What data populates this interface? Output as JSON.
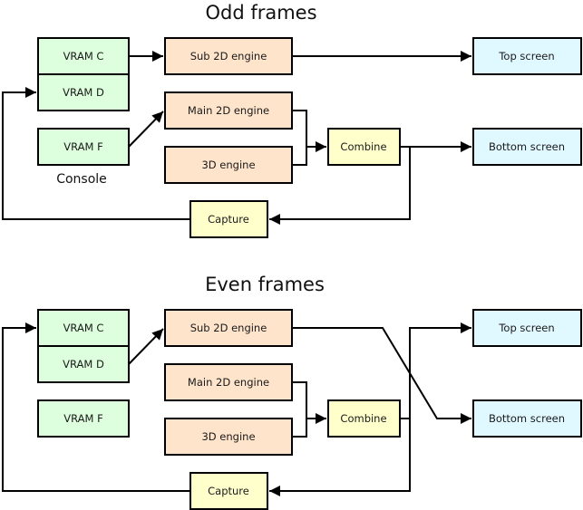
{
  "colors": {
    "memory": "#ddffdd",
    "engine": "#ffe4cc",
    "combiner": "#ffffcc",
    "screen": "#e0f8ff",
    "line": "#000000"
  },
  "panels": [
    {
      "id": "odd",
      "title": "Odd frames",
      "nodes": {
        "vram_c": {
          "label": "VRAM C",
          "kind": "memory"
        },
        "vram_d": {
          "label": "VRAM D",
          "kind": "memory"
        },
        "vram_f": {
          "label": "VRAM F",
          "kind": "memory"
        },
        "sub2d": {
          "label": "Sub 2D engine",
          "kind": "engine"
        },
        "main2d": {
          "label": "Main 2D engine",
          "kind": "engine"
        },
        "engine3d": {
          "label": "3D engine",
          "kind": "engine"
        },
        "combine": {
          "label": "Combine",
          "kind": "combiner"
        },
        "capture": {
          "label": "Capture",
          "kind": "combiner"
        },
        "top": {
          "label": "Top screen",
          "kind": "screen"
        },
        "bottom": {
          "label": "Bottom screen",
          "kind": "screen"
        }
      },
      "annotation": "Console",
      "edges": [
        {
          "from": "vram_c",
          "to": "sub2d"
        },
        {
          "from": "vram_f",
          "to": "main2d"
        },
        {
          "from": "sub2d",
          "to": "top"
        },
        {
          "from": "main2d",
          "to": "combine"
        },
        {
          "from": "engine3d",
          "to": "combine"
        },
        {
          "from": "combine",
          "to": "bottom"
        },
        {
          "from": "combine",
          "to": "capture"
        },
        {
          "from": "capture",
          "to": "vram_d"
        }
      ]
    },
    {
      "id": "even",
      "title": "Even frames",
      "nodes": {
        "vram_c": {
          "label": "VRAM C",
          "kind": "memory"
        },
        "vram_d": {
          "label": "VRAM D",
          "kind": "memory"
        },
        "vram_f": {
          "label": "VRAM F",
          "kind": "memory"
        },
        "sub2d": {
          "label": "Sub 2D engine",
          "kind": "engine"
        },
        "main2d": {
          "label": "Main 2D engine",
          "kind": "engine"
        },
        "engine3d": {
          "label": "3D engine",
          "kind": "engine"
        },
        "combine": {
          "label": "Combine",
          "kind": "combiner"
        },
        "capture": {
          "label": "Capture",
          "kind": "combiner"
        },
        "top": {
          "label": "Top screen",
          "kind": "screen"
        },
        "bottom": {
          "label": "Bottom screen",
          "kind": "screen"
        }
      },
      "annotation": "",
      "edges": [
        {
          "from": "vram_d",
          "to": "sub2d"
        },
        {
          "from": "sub2d",
          "to": "bottom"
        },
        {
          "from": "main2d",
          "to": "combine"
        },
        {
          "from": "engine3d",
          "to": "combine"
        },
        {
          "from": "combine",
          "to": "top"
        },
        {
          "from": "combine",
          "to": "capture"
        },
        {
          "from": "capture",
          "to": "vram_c"
        }
      ]
    }
  ]
}
